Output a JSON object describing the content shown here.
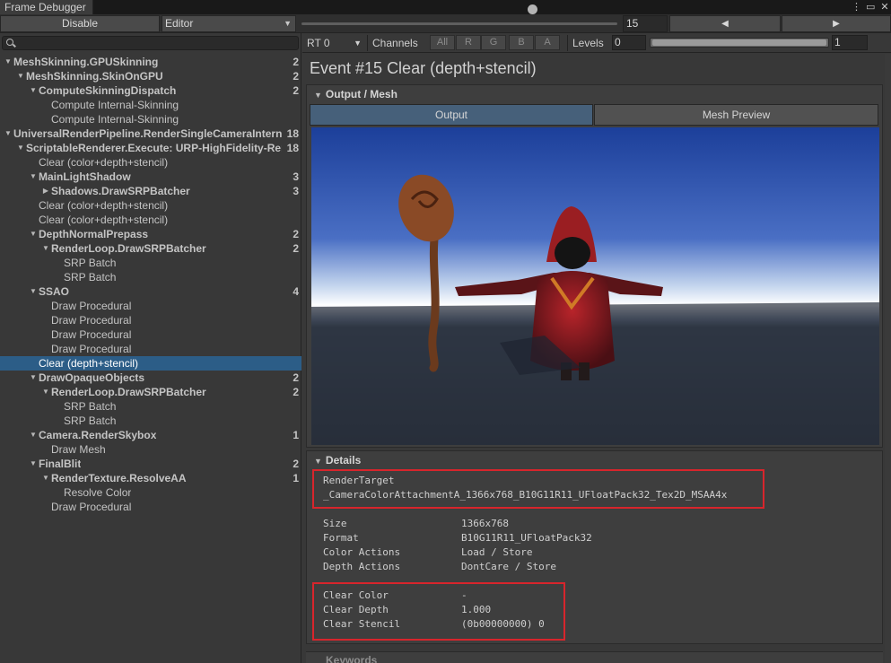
{
  "window": {
    "tab_title": "Frame Debugger",
    "menu_icon": "kebab-menu-icon",
    "maximize_icon": "maximize-icon",
    "close_icon": "close-icon"
  },
  "toolbar": {
    "disable_label": "Disable",
    "target_label": "Editor",
    "event_index": "15",
    "event_slider_fraction": 0.73,
    "prev_icon": "◀",
    "next_icon": "▶"
  },
  "search": {
    "placeholder": "",
    "icon": "search-icon"
  },
  "tree": [
    {
      "label": "MeshSkinning.GPUSkinning",
      "count": "2",
      "bold": true,
      "depth": 0,
      "toggle": "open"
    },
    {
      "label": "MeshSkinning.SkinOnGPU",
      "count": "2",
      "bold": true,
      "depth": 1,
      "toggle": "open"
    },
    {
      "label": "ComputeSkinningDispatch",
      "count": "2",
      "bold": true,
      "depth": 2,
      "toggle": "open"
    },
    {
      "label": "Compute Internal-Skinning",
      "count": "",
      "bold": false,
      "depth": 3,
      "toggle": ""
    },
    {
      "label": "Compute Internal-Skinning",
      "count": "",
      "bold": false,
      "depth": 3,
      "toggle": ""
    },
    {
      "label": "UniversalRenderPipeline.RenderSingleCameraInterna",
      "count": "18",
      "bold": true,
      "depth": 0,
      "toggle": "open"
    },
    {
      "label": "ScriptableRenderer.Execute: URP-HighFidelity-Rend",
      "count": "18",
      "bold": true,
      "depth": 1,
      "toggle": "open"
    },
    {
      "label": "Clear (color+depth+stencil)",
      "count": "",
      "bold": false,
      "depth": 2,
      "toggle": ""
    },
    {
      "label": "MainLightShadow",
      "count": "3",
      "bold": true,
      "depth": 2,
      "toggle": "open"
    },
    {
      "label": "Shadows.DrawSRPBatcher",
      "count": "3",
      "bold": true,
      "depth": 3,
      "toggle": "closed"
    },
    {
      "label": "Clear (color+depth+stencil)",
      "count": "",
      "bold": false,
      "depth": 2,
      "toggle": ""
    },
    {
      "label": "Clear (color+depth+stencil)",
      "count": "",
      "bold": false,
      "depth": 2,
      "toggle": ""
    },
    {
      "label": "DepthNormalPrepass",
      "count": "2",
      "bold": true,
      "depth": 2,
      "toggle": "open"
    },
    {
      "label": "RenderLoop.DrawSRPBatcher",
      "count": "2",
      "bold": true,
      "depth": 3,
      "toggle": "open"
    },
    {
      "label": "SRP Batch",
      "count": "",
      "bold": false,
      "depth": 4,
      "toggle": ""
    },
    {
      "label": "SRP Batch",
      "count": "",
      "bold": false,
      "depth": 4,
      "toggle": ""
    },
    {
      "label": "SSAO",
      "count": "4",
      "bold": true,
      "depth": 2,
      "toggle": "open"
    },
    {
      "label": "Draw Procedural",
      "count": "",
      "bold": false,
      "depth": 3,
      "toggle": ""
    },
    {
      "label": "Draw Procedural",
      "count": "",
      "bold": false,
      "depth": 3,
      "toggle": ""
    },
    {
      "label": "Draw Procedural",
      "count": "",
      "bold": false,
      "depth": 3,
      "toggle": ""
    },
    {
      "label": "Draw Procedural",
      "count": "",
      "bold": false,
      "depth": 3,
      "toggle": ""
    },
    {
      "label": "Clear (depth+stencil)",
      "count": "",
      "bold": false,
      "depth": 2,
      "toggle": "",
      "selected": true
    },
    {
      "label": "DrawOpaqueObjects",
      "count": "2",
      "bold": true,
      "depth": 2,
      "toggle": "open"
    },
    {
      "label": "RenderLoop.DrawSRPBatcher",
      "count": "2",
      "bold": true,
      "depth": 3,
      "toggle": "open"
    },
    {
      "label": "SRP Batch",
      "count": "",
      "bold": false,
      "depth": 4,
      "toggle": ""
    },
    {
      "label": "SRP Batch",
      "count": "",
      "bold": false,
      "depth": 4,
      "toggle": ""
    },
    {
      "label": "Camera.RenderSkybox",
      "count": "1",
      "bold": true,
      "depth": 2,
      "toggle": "open"
    },
    {
      "label": "Draw Mesh",
      "count": "",
      "bold": false,
      "depth": 3,
      "toggle": ""
    },
    {
      "label": "FinalBlit",
      "count": "2",
      "bold": true,
      "depth": 2,
      "toggle": "open"
    },
    {
      "label": "RenderTexture.ResolveAA",
      "count": "1",
      "bold": true,
      "depth": 3,
      "toggle": "open"
    },
    {
      "label": "Resolve Color",
      "count": "",
      "bold": false,
      "depth": 4,
      "toggle": ""
    },
    {
      "label": "Draw Procedural",
      "count": "",
      "bold": false,
      "depth": 3,
      "toggle": ""
    }
  ],
  "rt_bar": {
    "rt_select": "RT 0",
    "channels_label": "Channels",
    "channels": [
      "All",
      "R",
      "G",
      "B",
      "A"
    ],
    "levels_label": "Levels",
    "levels_min": "0",
    "levels_max": "1"
  },
  "event": {
    "title": "Event #15 Clear (depth+stencil)"
  },
  "output": {
    "header": "Output / Mesh",
    "tabs": [
      "Output",
      "Mesh Preview"
    ],
    "active_tab": "Output"
  },
  "details": {
    "header": "Details",
    "render_target_label": "RenderTarget",
    "render_target_value": "_CameraColorAttachmentA_1366x768_B10G11R11_UFloatPack32_Tex2D_MSAA4x",
    "props": [
      {
        "key": "Size",
        "value": "1366x768"
      },
      {
        "key": "Format",
        "value": "B10G11R11_UFloatPack32"
      },
      {
        "key": "Color Actions",
        "value": "Load / Store"
      },
      {
        "key": "Depth Actions",
        "value": "DontCare / Store"
      }
    ],
    "clear": [
      {
        "key": "Clear Color",
        "value": "-"
      },
      {
        "key": "Clear Depth",
        "value": "1.000"
      },
      {
        "key": "Clear Stencil",
        "value": "(0b00000000) 0"
      }
    ]
  },
  "keywords": {
    "header": "Keywords"
  },
  "colors": {
    "selection": "#2c5d87",
    "highlight_box": "#d8252c",
    "active_tab": "#46607a"
  }
}
